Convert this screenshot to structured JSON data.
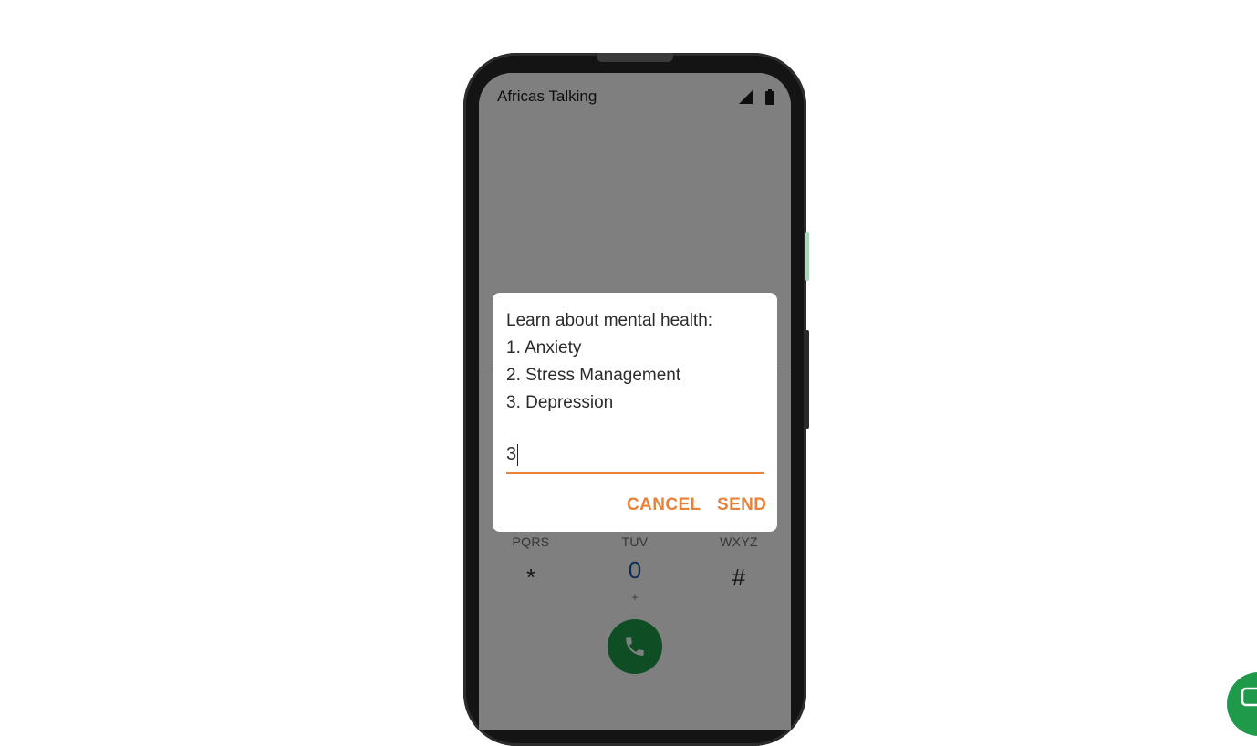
{
  "status_bar": {
    "carrier": "Africas Talking",
    "icons": [
      "signal-icon",
      "battery-icon"
    ]
  },
  "dialer": {
    "row_letters": [
      "PQRS",
      "TUV",
      "WXYZ"
    ],
    "row_keys": [
      "*",
      "0",
      "#"
    ],
    "zero_sub": "+",
    "call_icon": "phone-icon"
  },
  "ussd_dialog": {
    "lines": [
      "Learn about mental health:",
      "1. Anxiety",
      "2. Stress Management",
      "3. Depression"
    ],
    "input_value": "3",
    "cancel_label": "CANCEL",
    "send_label": "SEND"
  },
  "colors": {
    "accent": "#e8823a",
    "call_green": "#1e9a4a",
    "scrim": "rgba(0,0,0,0.5)"
  },
  "chat_widget": {
    "icon": "chat-icon"
  }
}
